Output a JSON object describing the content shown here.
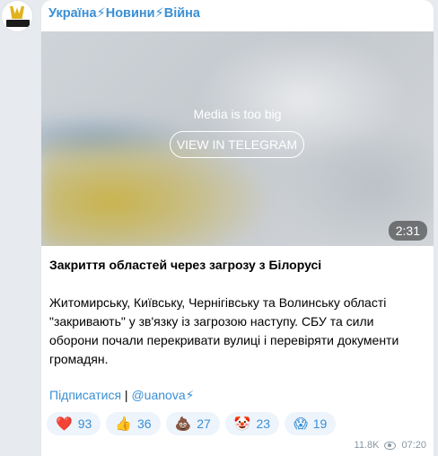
{
  "channel": {
    "name": "Україна⚡Новини⚡Війна",
    "avatar_icon": "trident-logo-icon"
  },
  "media": {
    "notice": "Media is too big",
    "button_label": "VIEW IN TELEGRAM",
    "duration": "2:31"
  },
  "post": {
    "title": "Закриття областей через загрозу з Білорусі",
    "body": "Житомирську, Київську, Чернігівську та Волинську області \"закривають\" у зв'язку із загрозою наступу. СБУ та сили оборони почали перекривати вулиці і перевіряти документи громадян.",
    "subscribe_label": "Підписатися",
    "separator": " | ",
    "channel_link": "@uanova⚡"
  },
  "reactions": [
    {
      "emoji": "❤️",
      "count": "93"
    },
    {
      "emoji": "👍",
      "count": "36"
    },
    {
      "emoji": "💩",
      "count": "27"
    },
    {
      "emoji": "🤡",
      "count": "23"
    },
    {
      "emoji": "😱",
      "count": "19"
    }
  ],
  "meta": {
    "views": "11.8K",
    "time": "07:20"
  },
  "colors": {
    "accent": "#3a8fd4",
    "background": "#e7ebf0",
    "reaction_bg": "#edf4fb"
  }
}
